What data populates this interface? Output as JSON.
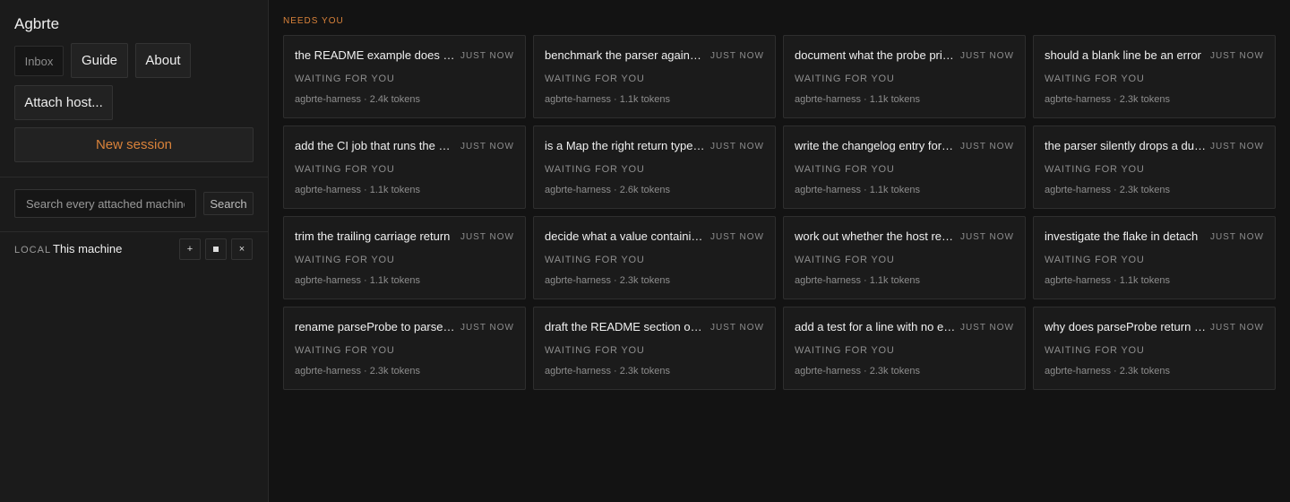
{
  "app": {
    "title": "Agbrte"
  },
  "nav": {
    "inbox": "Inbox",
    "guide": "Guide",
    "about": "About",
    "attach_host": "Attach host...",
    "new_session": "New session"
  },
  "search": {
    "placeholder": "Search every attached machine",
    "button": "Search"
  },
  "machine": {
    "tag": "LOCAL",
    "name": "This machine",
    "add_icon": "plus-icon",
    "stop_icon": "stop-icon",
    "close_icon": "close-icon"
  },
  "main": {
    "section_label": "NEEDS YOU",
    "cards": [
      {
        "title": "the README example does not match the output",
        "time": "JUST NOW",
        "status": "WAITING FOR YOU",
        "meta": "agbrte-harness · 2.4k tokens"
      },
      {
        "title": "benchmark the parser against the fixtures",
        "time": "JUST NOW",
        "status": "WAITING FOR YOU",
        "meta": "agbrte-harness · 1.1k tokens"
      },
      {
        "title": "document what the probe prints",
        "time": "JUST NOW",
        "status": "WAITING FOR YOU",
        "meta": "agbrte-harness · 1.1k tokens"
      },
      {
        "title": "should a blank line be an error",
        "time": "JUST NOW",
        "status": "WAITING FOR YOU",
        "meta": "agbrte-harness · 2.3k tokens"
      },
      {
        "title": "add the CI job that runs the probe",
        "time": "JUST NOW",
        "status": "WAITING FOR YOU",
        "meta": "agbrte-harness · 1.1k tokens"
      },
      {
        "title": "is a Map the right return type here",
        "time": "JUST NOW",
        "status": "WAITING FOR YOU",
        "meta": "agbrte-harness · 2.6k tokens"
      },
      {
        "title": "write the changelog entry for the parser",
        "time": "JUST NOW",
        "status": "WAITING FOR YOU",
        "meta": "agbrte-harness · 1.1k tokens"
      },
      {
        "title": "the parser silently drops a duplicate key",
        "time": "JUST NOW",
        "status": "WAITING FOR YOU",
        "meta": "agbrte-harness · 2.3k tokens"
      },
      {
        "title": "trim the trailing carriage return",
        "time": "JUST NOW",
        "status": "WAITING FOR YOU",
        "meta": "agbrte-harness · 1.1k tokens"
      },
      {
        "title": "decide what a value containing an equals sign means",
        "time": "JUST NOW",
        "status": "WAITING FOR YOU",
        "meta": "agbrte-harness · 2.3k tokens"
      },
      {
        "title": "work out whether the host reports the version",
        "time": "JUST NOW",
        "status": "WAITING FOR YOU",
        "meta": "agbrte-harness · 1.1k tokens"
      },
      {
        "title": "investigate the flake in detach",
        "time": "JUST NOW",
        "status": "WAITING FOR YOU",
        "meta": "agbrte-harness · 1.1k tokens"
      },
      {
        "title": "rename parseProbe to parseProbeOutput",
        "time": "JUST NOW",
        "status": "WAITING FOR YOU",
        "meta": "agbrte-harness · 2.3k tokens"
      },
      {
        "title": "draft the README section on probes",
        "time": "JUST NOW",
        "status": "WAITING FOR YOU",
        "meta": "agbrte-harness · 2.3k tokens"
      },
      {
        "title": "add a test for a line with no equals sign",
        "time": "JUST NOW",
        "status": "WAITING FOR YOU",
        "meta": "agbrte-harness · 2.3k tokens"
      },
      {
        "title": "why does parseProbe return undefined",
        "time": "JUST NOW",
        "status": "WAITING FOR YOU",
        "meta": "agbrte-harness · 2.3k tokens"
      }
    ]
  }
}
